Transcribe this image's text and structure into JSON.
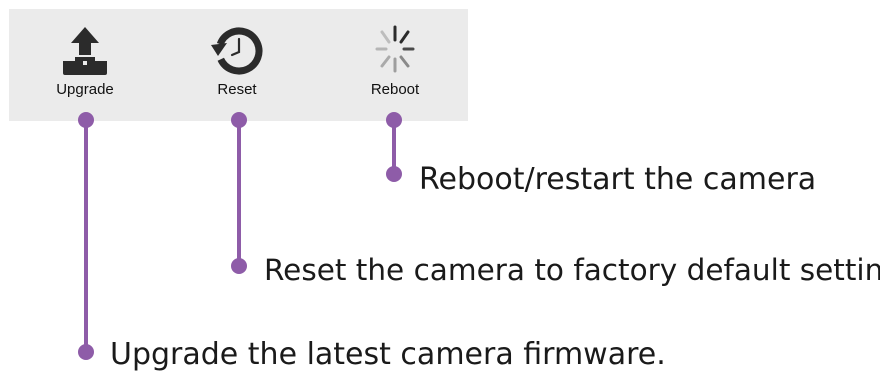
{
  "toolbar": {
    "buttons": [
      {
        "id": "upgrade",
        "label": "Upgrade",
        "icon": "upload-icon"
      },
      {
        "id": "reset",
        "label": "Reset",
        "icon": "reset-clock-icon"
      },
      {
        "id": "reboot",
        "label": "Reboot",
        "icon": "spinner-icon"
      }
    ]
  },
  "callouts": {
    "reboot": "Reboot/restart the camera",
    "reset": "Reset the camera to factory default settings",
    "upgrade": "Upgrade the latest camera firmware."
  },
  "colors": {
    "toolbar_bg": "#ebebeb",
    "callout_line": "#8e5ca8",
    "icon_dark": "#2b2b2b",
    "icon_grey": "#bdbdbd"
  }
}
